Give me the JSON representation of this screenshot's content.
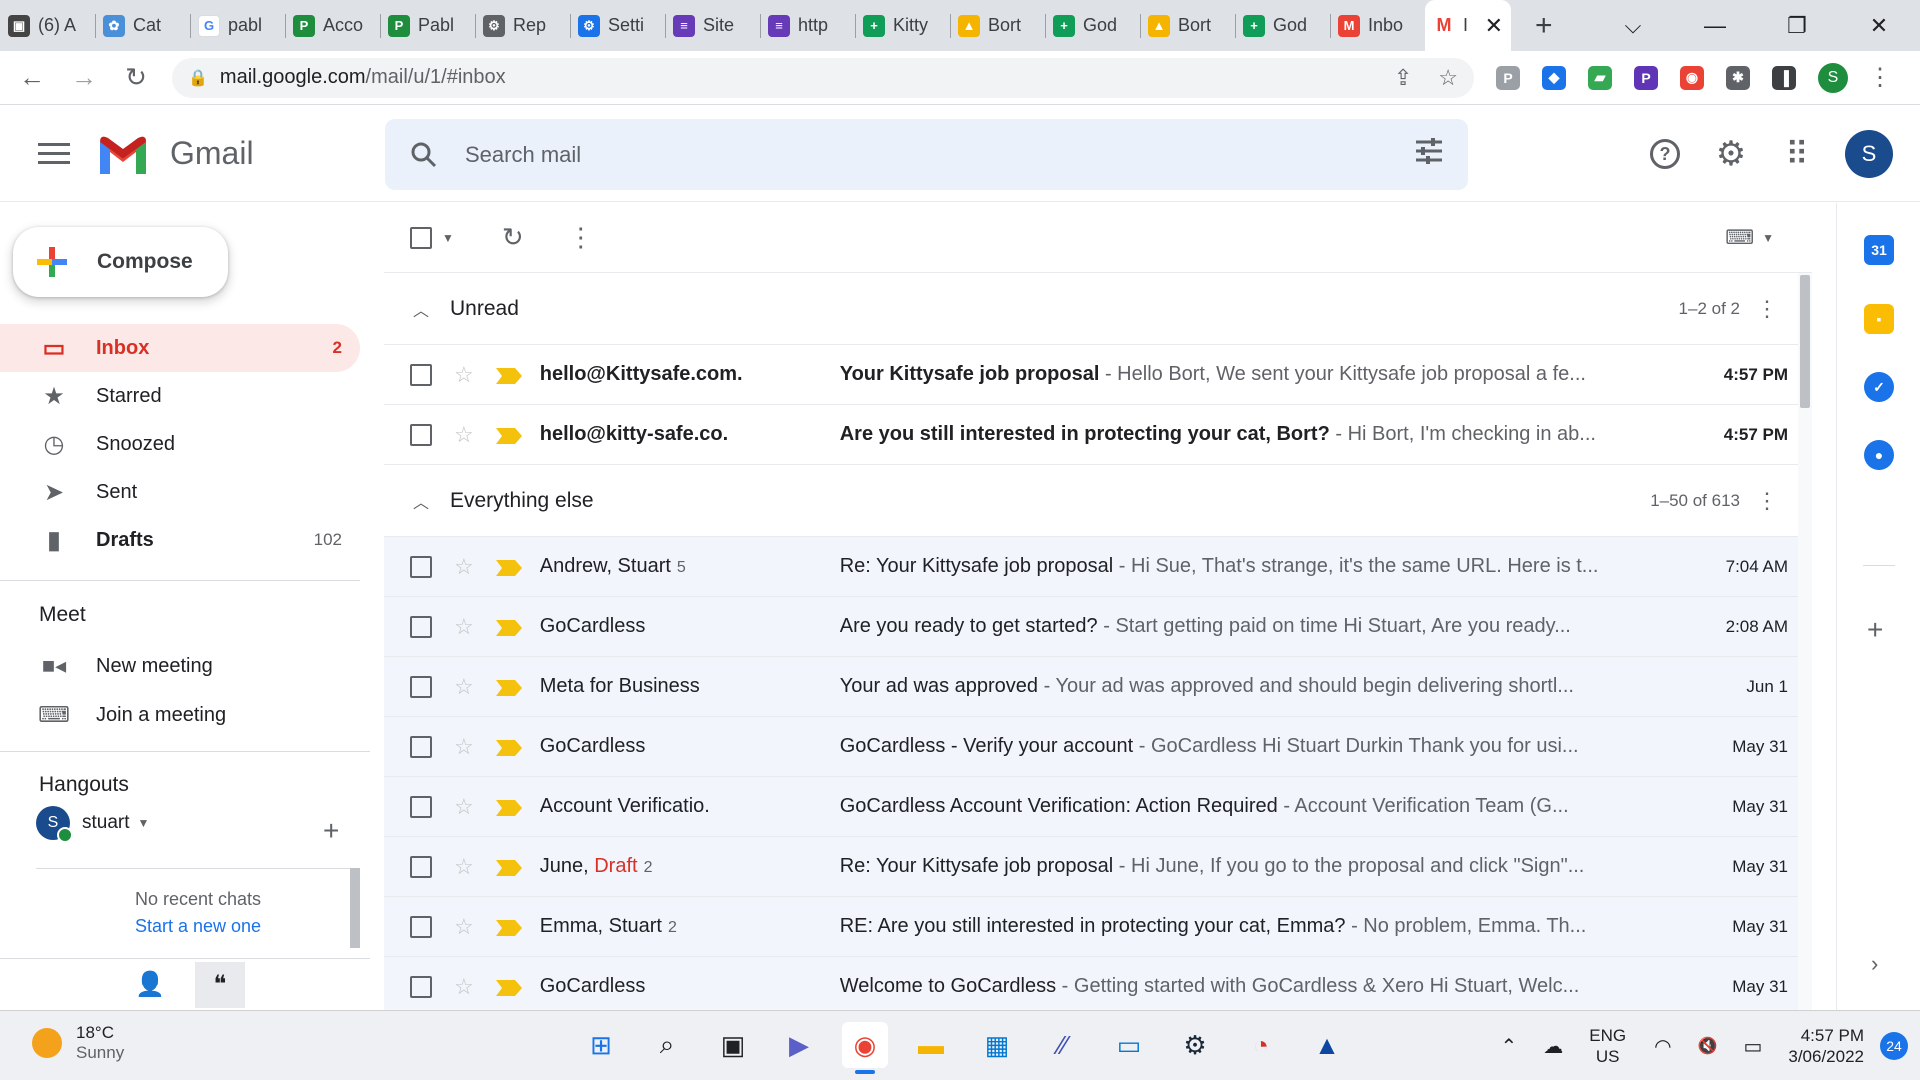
{
  "browser": {
    "tabs": [
      {
        "label": "(6) A",
        "fav_color": "#444",
        "fav_glyph": "▣"
      },
      {
        "label": "Cat",
        "fav_color": "#4a90d9",
        "fav_glyph": "✿"
      },
      {
        "label": "pabl",
        "fav_color": "#ffffff",
        "fav_glyph": "G"
      },
      {
        "label": "Acco",
        "fav_color": "#1e8e3e",
        "fav_glyph": "P"
      },
      {
        "label": "Pabl",
        "fav_color": "#1e8e3e",
        "fav_glyph": "P"
      },
      {
        "label": "Rep",
        "fav_color": "#5f6368",
        "fav_glyph": "⚙"
      },
      {
        "label": "Setti",
        "fav_color": "#1a73e8",
        "fav_glyph": "⚙"
      },
      {
        "label": "Site",
        "fav_color": "#673ab7",
        "fav_glyph": "≡"
      },
      {
        "label": "http",
        "fav_color": "#673ab7",
        "fav_glyph": "≡"
      },
      {
        "label": "Kitty",
        "fav_color": "#0f9d58",
        "fav_glyph": "+"
      },
      {
        "label": "Bort",
        "fav_color": "#f4b400",
        "fav_glyph": "▲"
      },
      {
        "label": "God",
        "fav_color": "#0f9d58",
        "fav_glyph": "+"
      },
      {
        "label": "Bort",
        "fav_color": "#f4b400",
        "fav_glyph": "▲"
      },
      {
        "label": "God",
        "fav_color": "#0f9d58",
        "fav_glyph": "+"
      },
      {
        "label": "Inbo",
        "fav_color": "#ea4335",
        "fav_glyph": "M"
      }
    ],
    "active_tab": {
      "label": "I",
      "fav_glyph": "M",
      "close": "✕"
    },
    "new_tab": "+",
    "window_controls": {
      "list": "⌵",
      "minimize": "—",
      "restore": "❐",
      "close": "✕"
    },
    "nav": {
      "back": "←",
      "forward": "→",
      "reload": "↻"
    },
    "url_host": "mail.google.com",
    "url_path": "/mail/u/1/#inbox",
    "lock": "🔒",
    "omnibox_icons": {
      "share": "⇪",
      "bookmark": "☆"
    },
    "extensions": [
      {
        "glyph": "P",
        "color": "#9aa0a6"
      },
      {
        "glyph": "◆",
        "color": "#1a73e8"
      },
      {
        "glyph": "▰",
        "color": "#34a853"
      },
      {
        "glyph": "P",
        "color": "#5f35b5"
      },
      {
        "glyph": "◉",
        "color": "#ea4335"
      },
      {
        "glyph": "✱",
        "color": "#5f6368"
      },
      {
        "glyph": "▐",
        "color": "#3c4043"
      }
    ],
    "profile_initial": "S",
    "menu": "⋮"
  },
  "gmail": {
    "brand": "Gmail",
    "search_placeholder": "Search mail",
    "help": "?",
    "settings": "⚙",
    "apps": "⠿",
    "avatar_initial": "S",
    "compose_label": "Compose",
    "nav": [
      {
        "label": "Inbox",
        "count": "2",
        "icon": "inbox-icon",
        "glyph": "▭"
      },
      {
        "label": "Starred",
        "count": "",
        "icon": "star-icon",
        "glyph": "★"
      },
      {
        "label": "Snoozed",
        "count": "",
        "icon": "clock-icon",
        "glyph": "◷"
      },
      {
        "label": "Sent",
        "count": "",
        "icon": "send-icon",
        "glyph": "➤"
      },
      {
        "label": "Drafts",
        "count": "102",
        "icon": "draft-icon",
        "glyph": "▮"
      }
    ],
    "meet": {
      "heading": "Meet",
      "new_meeting": "New meeting",
      "join_meeting": "Join a meeting"
    },
    "hangouts": {
      "heading": "Hangouts",
      "user_initial": "S",
      "user_name": "stuart",
      "no_recent": "No recent chats",
      "start_new": "Start a new one"
    },
    "sections": {
      "unread": {
        "title": "Unread",
        "range": "1–2 of 2"
      },
      "everything": {
        "title": "Everything else",
        "range": "1–50 of 613"
      }
    },
    "unread_rows": [
      {
        "sender": "hello@Kittysafe.com.",
        "count": "",
        "draft": "",
        "subject": "Your Kittysafe job proposal",
        "snippet": " - Hello Bort, We sent your Kittysafe job proposal a fe...",
        "date": "4:57 PM"
      },
      {
        "sender": "hello@kitty-safe.co.",
        "count": "",
        "draft": "",
        "subject": "Are you still interested in protecting your cat, Bort?",
        "snippet": " - Hi Bort, I'm checking in ab...",
        "date": "4:57 PM"
      }
    ],
    "rows": [
      {
        "sender": "Andrew, Stuart",
        "count": "5",
        "draft": "",
        "subject": "Re: Your Kittysafe job proposal",
        "snippet": " - Hi Sue, That's strange, it's the same URL. Here is t...",
        "date": "7:04 AM"
      },
      {
        "sender": "GoCardless",
        "count": "",
        "draft": "",
        "subject": "Are you ready to get started?",
        "snippet": " - Start getting paid on time Hi Stuart, Are you ready...",
        "date": "2:08 AM"
      },
      {
        "sender": "Meta for Business",
        "count": "",
        "draft": "",
        "subject": "Your ad was approved",
        "snippet": " - Your ad was approved and should begin delivering shortl...",
        "date": "Jun 1"
      },
      {
        "sender": "GoCardless",
        "count": "",
        "draft": "",
        "subject": "GoCardless - Verify your account",
        "snippet": " - GoCardless Hi Stuart Durkin Thank you for usi...",
        "date": "May 31"
      },
      {
        "sender": "Account Verificatio.",
        "count": "",
        "draft": "",
        "subject": "GoCardless Account Verification: Action Required",
        "snippet": " - Account Verification Team (G...",
        "date": "May 31"
      },
      {
        "sender": "June, ",
        "count": "2",
        "draft": "Draft",
        "subject": "Re: Your Kittysafe job proposal",
        "snippet": " - Hi June, If you go to the proposal and click \"Sign\"...",
        "date": "May 31"
      },
      {
        "sender": "Emma, Stuart",
        "count": "2",
        "draft": "",
        "subject": "RE: Are you still interested in protecting your cat, Emma?",
        "snippet": " - No problem, Emma. Th...",
        "date": "May 31"
      },
      {
        "sender": "GoCardless",
        "count": "",
        "draft": "",
        "subject": "Welcome to GoCardless",
        "snippet": " - Getting started with GoCardless & Xero Hi Stuart, Welc...",
        "date": "May 31"
      }
    ],
    "side_panel": [
      {
        "name": "calendar-icon",
        "glyph": "31",
        "color": "#1a73e8"
      },
      {
        "name": "keep-icon",
        "glyph": "▪",
        "color": "#fbbc04"
      },
      {
        "name": "tasks-icon",
        "glyph": "✓",
        "color": "#1a73e8"
      },
      {
        "name": "contacts-icon",
        "glyph": "●",
        "color": "#1a73e8"
      }
    ]
  },
  "taskbar": {
    "temperature": "18°C",
    "condition": "Sunny",
    "apps": [
      {
        "name": "start-button",
        "glyph": "⊞",
        "color": "#1a73e8"
      },
      {
        "name": "search-taskbar-icon",
        "glyph": "⌕",
        "color": "#202124"
      },
      {
        "name": "task-view-icon",
        "glyph": "▣",
        "color": "#202124"
      },
      {
        "name": "teams-chat-icon",
        "glyph": "▶",
        "color": "#5b5fc7"
      },
      {
        "name": "chrome-icon",
        "glyph": "◉",
        "color": "#ea4335"
      },
      {
        "name": "file-explorer-icon",
        "glyph": "▬",
        "color": "#f4b400"
      },
      {
        "name": "store-icon",
        "glyph": "▦",
        "color": "#0078d4"
      },
      {
        "name": "vscode-app-icon",
        "glyph": "⁄⁄",
        "color": "#3f51b5"
      },
      {
        "name": "remote-desktop-icon",
        "glyph": "▭",
        "color": "#0078d4"
      },
      {
        "name": "steam-icon",
        "glyph": "⚙",
        "color": "#1b2838"
      },
      {
        "name": "antivirus-icon",
        "glyph": "◔",
        "color": "#d93025"
      },
      {
        "name": "app-icon",
        "glyph": "▲",
        "color": "#0d47a1"
      }
    ],
    "lang1": "ENG",
    "lang2": "US",
    "time": "4:57 PM",
    "date": "3/06/2022",
    "notifications": "24",
    "tray_chevron": "⌃",
    "tray_icons": {
      "wifi": "◠",
      "volume": "🔇",
      "battery": "▭"
    }
  }
}
